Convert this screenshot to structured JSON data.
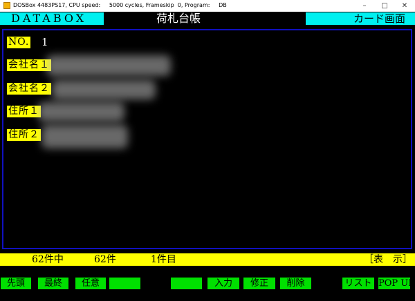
{
  "window": {
    "title": "DOSBox 4483PS17, CPU speed:     5000 cycles, Frameskip  0, Program:     DB",
    "controls": [
      "–",
      "□",
      "✕"
    ]
  },
  "header": {
    "app_name": "DATABOX",
    "screen_title": "荷札台帳",
    "mode": "カード画面"
  },
  "record": {
    "number_label": "NO.",
    "number_value": "1",
    "fields": [
      {
        "label": "会社名１",
        "value": "(blurred)"
      },
      {
        "label": "会社名２",
        "value": "(blurred)"
      },
      {
        "label": "住所１",
        "value": "(blurred)"
      },
      {
        "label": "住所２",
        "value": "(blurred)"
      }
    ]
  },
  "status": {
    "total": "62件中",
    "count": "62件",
    "position": "1件目",
    "display": "［表　示］"
  },
  "function_keys": [
    "先頭",
    "最終",
    "任意",
    "",
    "",
    "入力",
    "修正",
    "削除",
    "リスト",
    "POP UP"
  ]
}
